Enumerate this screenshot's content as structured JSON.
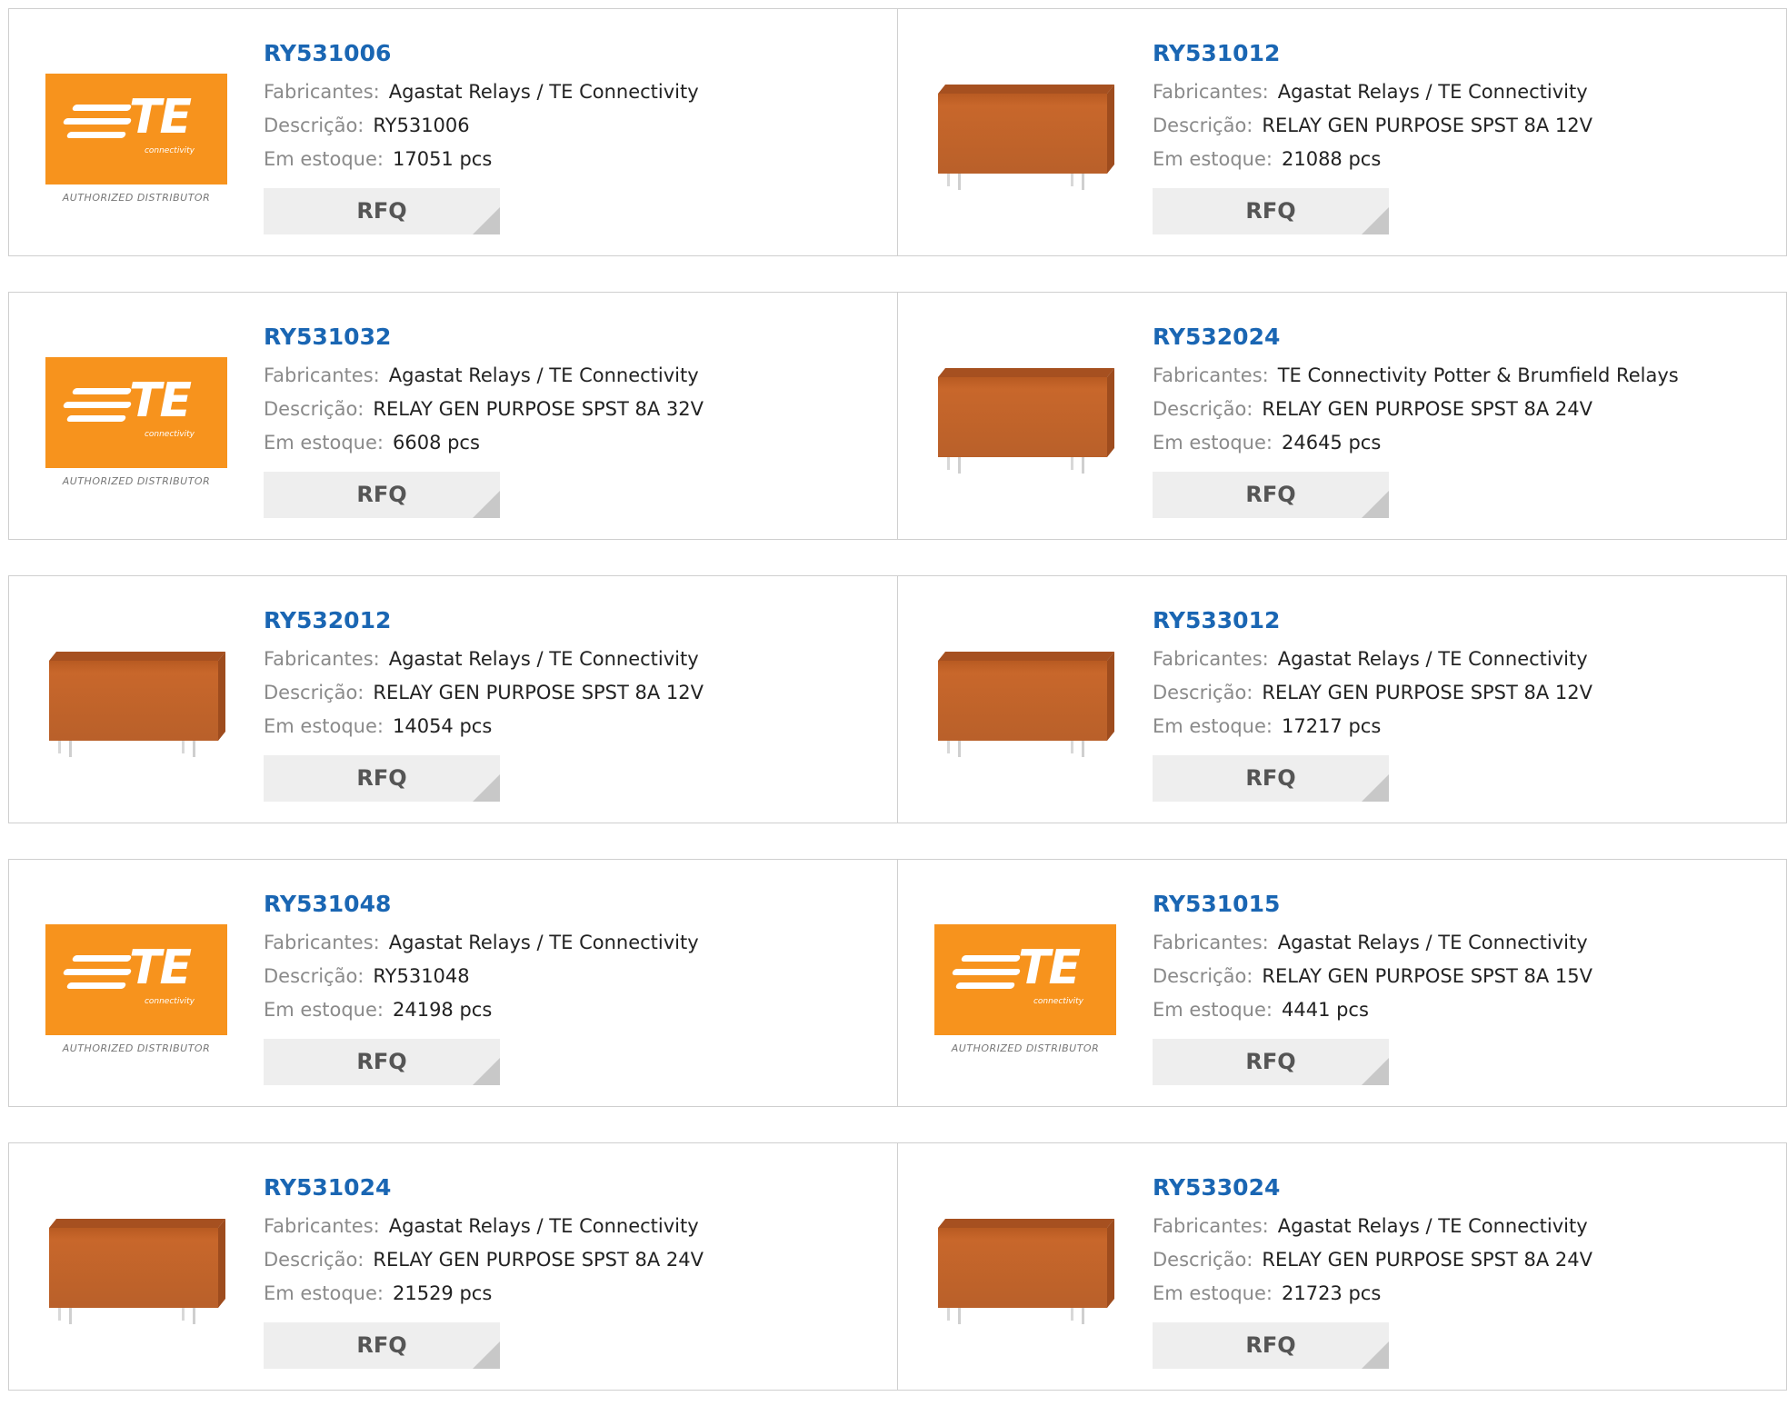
{
  "labels": {
    "manufacturer": "Fabricantes:",
    "description": "Descrição:",
    "stock": "Em estoque:",
    "rfq": "RFQ",
    "te_logo_text": "TE",
    "te_logo_sub": "connectivity",
    "te_authorized": "AUTHORIZED DISTRIBUTOR"
  },
  "colors": {
    "part_link": "#1a66b3",
    "te_orange": "#f7931d",
    "relay_body": "#c0642a"
  },
  "products": [
    {
      "part": "RY531006",
      "manufacturer": "Agastat Relays / TE Connectivity",
      "description": "RY531006",
      "stock": "17051 pcs",
      "image": "te-logo"
    },
    {
      "part": "RY531012",
      "manufacturer": "Agastat Relays / TE Connectivity",
      "description": "RELAY GEN PURPOSE SPST 8A 12V",
      "stock": "21088 pcs",
      "image": "relay"
    },
    {
      "part": "RY531032",
      "manufacturer": "Agastat Relays / TE Connectivity",
      "description": "RELAY GEN PURPOSE SPST 8A 32V",
      "stock": "6608 pcs",
      "image": "te-logo"
    },
    {
      "part": "RY532024",
      "manufacturer": "TE Connectivity Potter & Brumfield Relays",
      "description": "RELAY GEN PURPOSE SPST 8A 24V",
      "stock": "24645 pcs",
      "image": "relay"
    },
    {
      "part": "RY532012",
      "manufacturer": "Agastat Relays / TE Connectivity",
      "description": "RELAY GEN PURPOSE SPST 8A 12V",
      "stock": "14054 pcs",
      "image": "relay"
    },
    {
      "part": "RY533012",
      "manufacturer": "Agastat Relays / TE Connectivity",
      "description": "RELAY GEN PURPOSE SPST 8A 12V",
      "stock": "17217 pcs",
      "image": "relay"
    },
    {
      "part": "RY531048",
      "manufacturer": "Agastat Relays / TE Connectivity",
      "description": "RY531048",
      "stock": "24198 pcs",
      "image": "te-logo"
    },
    {
      "part": "RY531015",
      "manufacturer": "Agastat Relays / TE Connectivity",
      "description": "RELAY GEN PURPOSE SPST 8A 15V",
      "stock": "4441 pcs",
      "image": "te-logo"
    },
    {
      "part": "RY531024",
      "manufacturer": "Agastat Relays / TE Connectivity",
      "description": "RELAY GEN PURPOSE SPST 8A 24V",
      "stock": "21529 pcs",
      "image": "relay"
    },
    {
      "part": "RY533024",
      "manufacturer": "Agastat Relays / TE Connectivity",
      "description": "RELAY GEN PURPOSE SPST 8A 24V",
      "stock": "21723 pcs",
      "image": "relay"
    }
  ]
}
